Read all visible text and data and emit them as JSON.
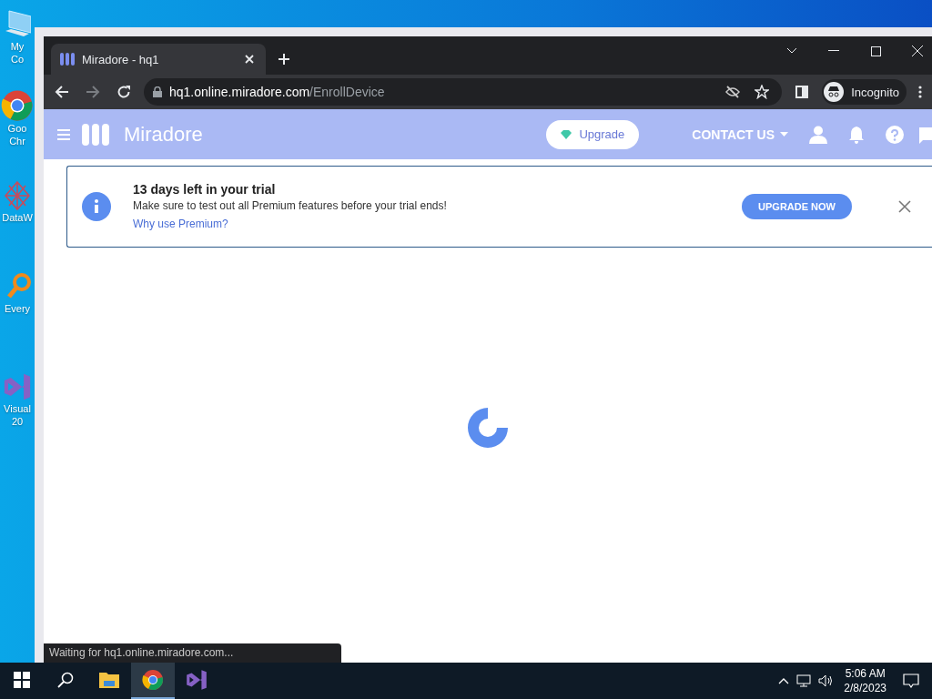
{
  "desktop": {
    "icons": [
      {
        "kind": "computer",
        "label": "My Co"
      },
      {
        "kind": "chrome",
        "label": "Goo Chr"
      },
      {
        "kind": "molecule",
        "label": "DataW"
      },
      {
        "kind": "magnifier",
        "label": "Every"
      },
      {
        "kind": "visualstudio",
        "label": "Visual 20"
      }
    ]
  },
  "browser": {
    "tab": {
      "title": "Miradore - hq1"
    },
    "address": {
      "host": "hq1.online.miradore.com",
      "path": "/EnrollDevice"
    },
    "profile": "Incognito",
    "status": "Waiting for hq1.online.miradore.com..."
  },
  "app_header": {
    "logo": "Miradore",
    "upgrade": "Upgrade",
    "contact": "CONTACT US"
  },
  "notice": {
    "title": "13 days left in your trial",
    "message": "Make sure to test out all Premium features before your trial ends!",
    "link": "Why use Premium?",
    "button": "UPGRADE NOW"
  },
  "taskbar": {
    "apps": [
      {
        "kind": "explorer",
        "selected": false
      },
      {
        "kind": "chrome",
        "selected": true
      },
      {
        "kind": "visualstudio",
        "selected": false
      }
    ],
    "time": "5:06 AM",
    "date": "2/8/2023"
  }
}
